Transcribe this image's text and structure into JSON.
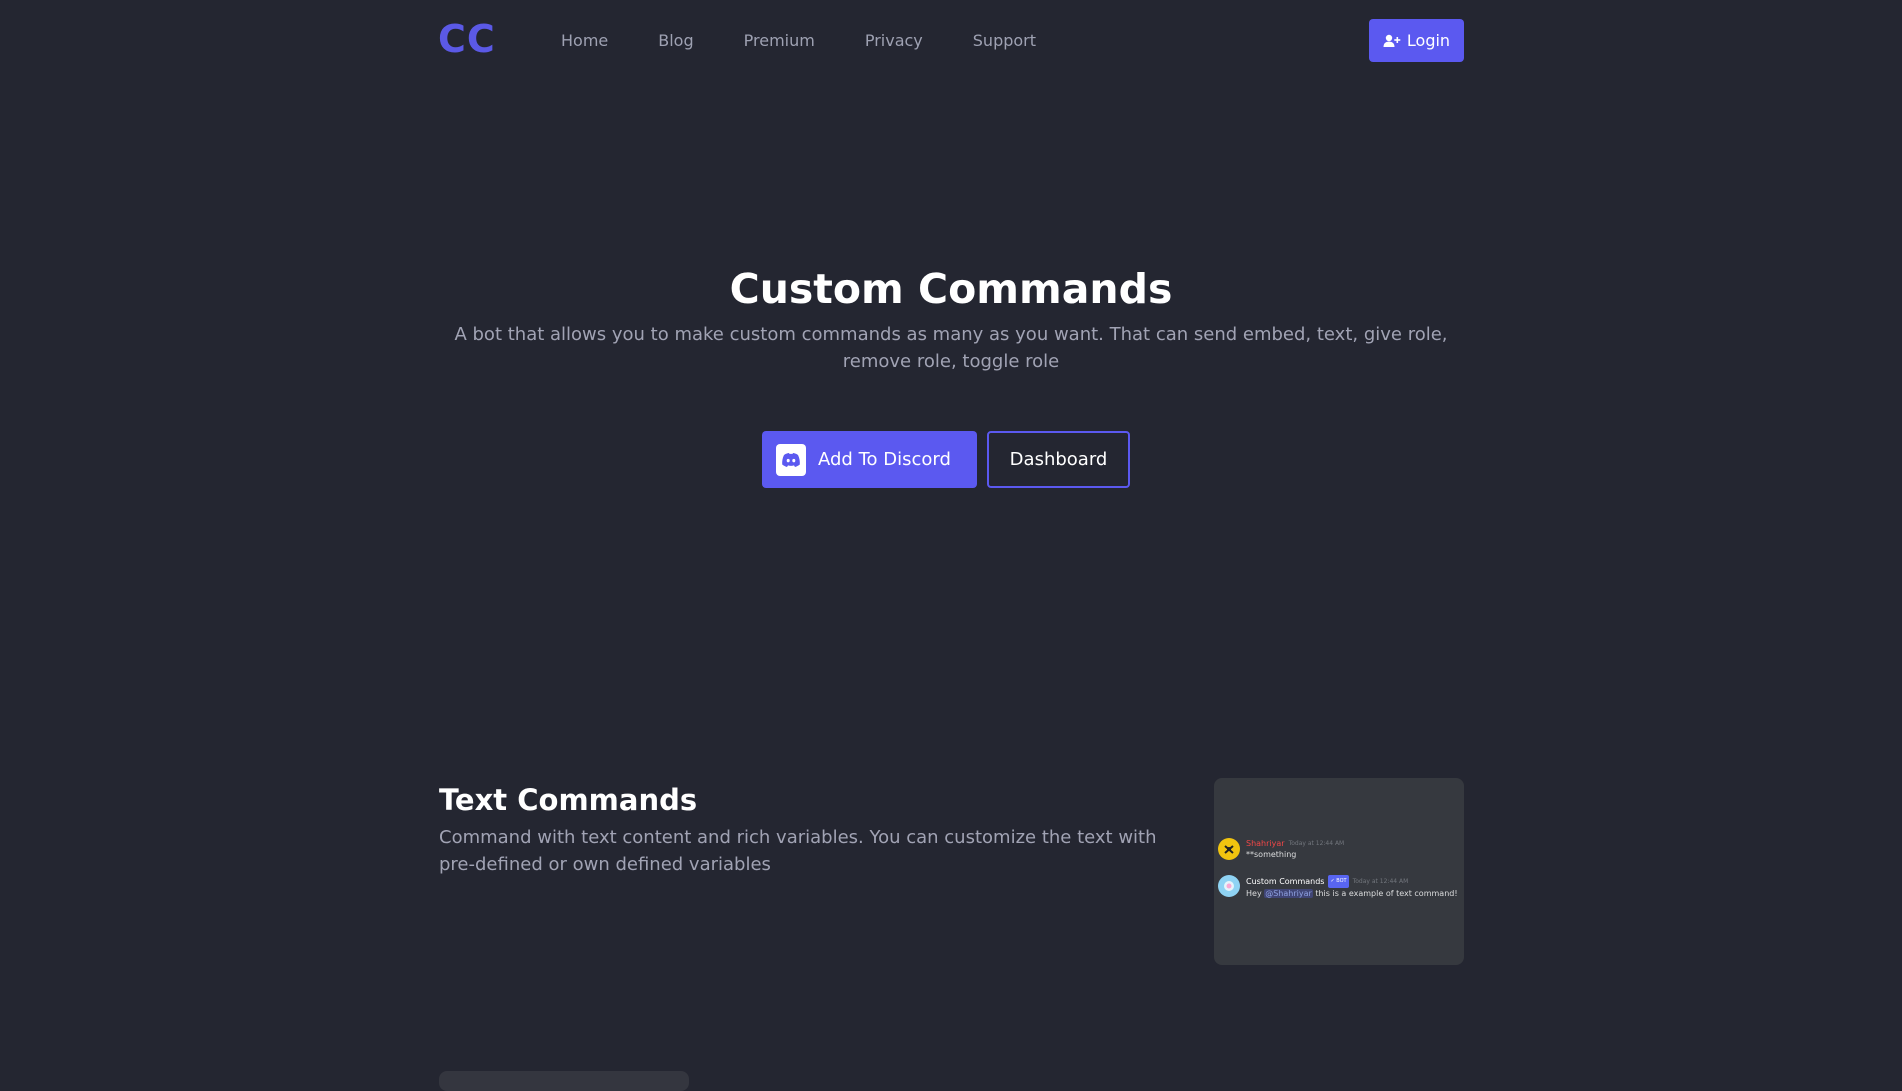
{
  "navbar": {
    "logo": "CC",
    "links": [
      "Home",
      "Blog",
      "Premium",
      "Privacy",
      "Support"
    ],
    "login_label": "Login",
    "login_icon": "user-plus-icon"
  },
  "hero": {
    "title": "Custom Commands",
    "subtitle": "A bot that allows you to make custom commands as many as you want. That can send embed, text, give role, remove role, toggle role",
    "add_button_label": "Add To Discord",
    "add_button_icon": "discord-icon",
    "dashboard_button_label": "Dashboard"
  },
  "feature": {
    "title": "Text Commands",
    "description": "Command with text content and rich variables. You can customize the text with pre-defined or own defined variables",
    "preview": {
      "messages": [
        {
          "author": "Shahriyar",
          "author_color": "#f04747",
          "time": "Today at 12:44 AM",
          "text": "**something"
        },
        {
          "author": "Custom Commands",
          "author_color": "#ffffff",
          "bot_tag": "✓ BOT",
          "time": "Today at 12:44 AM",
          "text_prefix": "Hey",
          "mention": "@Shahriyar",
          "text_suffix": "this is a example of text command!"
        }
      ]
    }
  },
  "colors": {
    "background": "#242631",
    "accent": "#5b59f0",
    "muted_text": "#a1a3b4"
  }
}
